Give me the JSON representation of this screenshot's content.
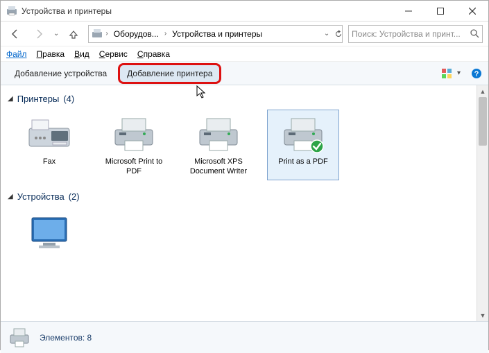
{
  "window": {
    "title": "Устройства и принтеры"
  },
  "nav": {
    "breadcrumb": {
      "level1": "Оборудов...",
      "level2": "Устройства и принтеры"
    }
  },
  "search": {
    "placeholder": "Поиск: Устройства и принт..."
  },
  "menu": {
    "file": "Файл",
    "edit": "Правка",
    "view": "Вид",
    "service": "Сервис",
    "help": "Справка"
  },
  "toolbar": {
    "add_device": "Добавление устройства",
    "add_printer": "Добавление принтера"
  },
  "groups": {
    "printers": {
      "title": "Принтеры",
      "count": "(4)"
    },
    "devices": {
      "title": "Устройства",
      "count": "(2)"
    }
  },
  "printers": [
    {
      "name": "Fax"
    },
    {
      "name": "Microsoft Print to PDF"
    },
    {
      "name": "Microsoft XPS Document Writer"
    },
    {
      "name": "Print as a PDF",
      "default": true,
      "selected": true
    }
  ],
  "status": {
    "elements_label": "Элементов:",
    "elements_count": "8"
  }
}
